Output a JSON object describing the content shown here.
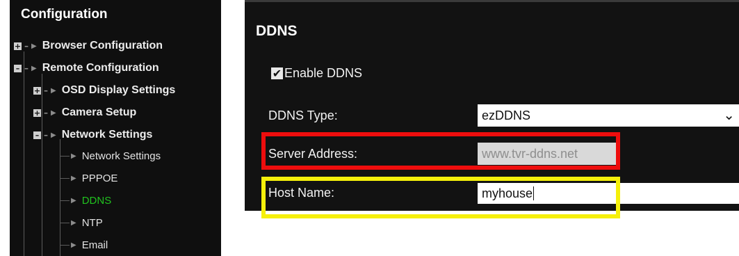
{
  "tree": {
    "title": "Configuration",
    "items": [
      {
        "label": "Browser Configuration"
      },
      {
        "label": "Remote Configuration"
      },
      {
        "label": "OSD Display Settings"
      },
      {
        "label": "Camera Setup"
      },
      {
        "label": "Network Settings"
      },
      {
        "label": "Network Settings"
      },
      {
        "label": "PPPOE"
      },
      {
        "label": "DDNS"
      },
      {
        "label": "NTP"
      },
      {
        "label": "Email"
      }
    ],
    "active_color": "#21c21f"
  },
  "ddns": {
    "title": "DDNS",
    "enable_label": "Enable DDNS",
    "enable_checked": true,
    "type_label": "DDNS Type:",
    "type_value": "ezDDNS",
    "server_label": "Server Address:",
    "server_value": "www.tvr-ddns.net",
    "host_label": "Host Name:",
    "host_value": "myhouse"
  },
  "highlights": {
    "server_color": "#ee0d0d",
    "host_color": "#f5f00a"
  },
  "icons": {
    "expand": "plus-box-icon",
    "collapse": "minus-box-icon",
    "leaf": "triangle-right-icon",
    "dropdown": "chevron-down-icon",
    "checkbox": "checkmark-icon"
  }
}
